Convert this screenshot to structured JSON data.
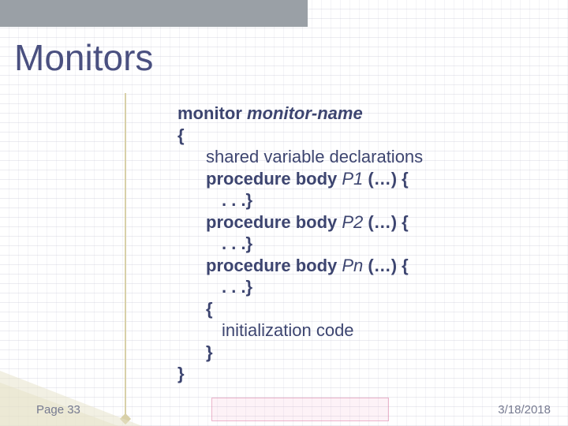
{
  "title": "Monitors",
  "code": {
    "kw_monitor": "monitor",
    "monitor_name": "monitor-name",
    "open_brace": "{",
    "shared_decl": "shared variable declarations",
    "proc_kw": "procedure body",
    "p1": "P1",
    "p2": "P2",
    "pn": "Pn",
    "tail": " (…) {",
    "ellipsis_close": ". . .}",
    "inner_open": "{",
    "init_code": "initialization code",
    "inner_close": "}",
    "close_brace": "}"
  },
  "footer": {
    "page": "Page 33",
    "date": "3/18/2018"
  }
}
